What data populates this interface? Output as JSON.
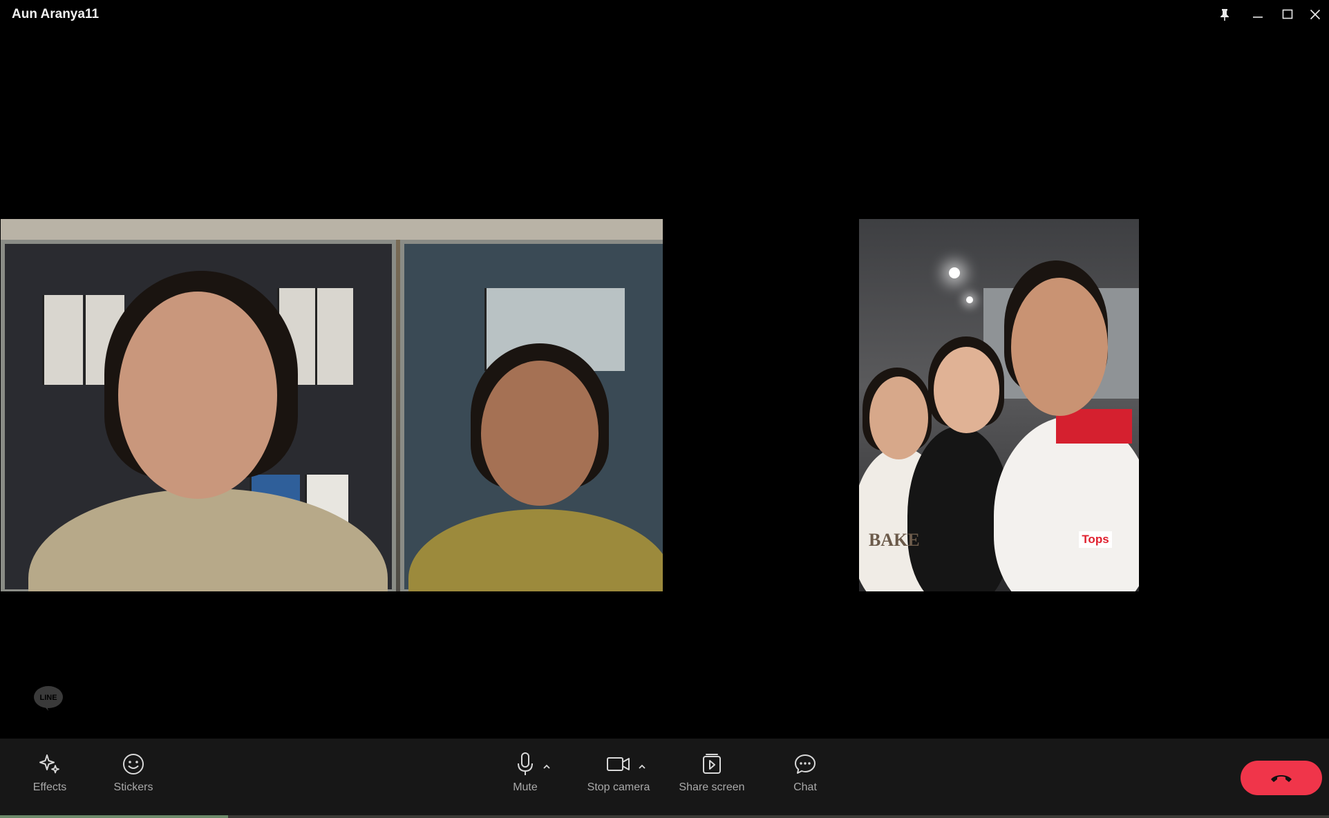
{
  "window": {
    "title": "Aun Aranya11"
  },
  "icons": {
    "pin": "pin-icon",
    "minimize": "minimize-icon",
    "maximize": "maximize-icon",
    "close": "close-icon",
    "line_logo": "line-logo-icon",
    "effects": "sparkle-icon",
    "stickers": "smiley-icon",
    "mute": "microphone-icon",
    "camera": "video-camera-icon",
    "share": "share-screen-icon",
    "chat": "chat-bubble-icon",
    "end_call": "phone-hangup-icon"
  },
  "line_logo": {
    "text": "LINE"
  },
  "toolbar": {
    "effects_label": "Effects",
    "stickers_label": "Stickers",
    "mute_label": "Mute",
    "camera_label": "Stop camera",
    "share_label": "Share screen",
    "chat_label": "Chat"
  },
  "right_video": {
    "badge_text": "Tops",
    "apron_text": "BAKE"
  },
  "colors": {
    "background": "#000000",
    "toolbar_bg": "#171717",
    "end_call": "#f0354a",
    "label": "#a9a9a9"
  }
}
